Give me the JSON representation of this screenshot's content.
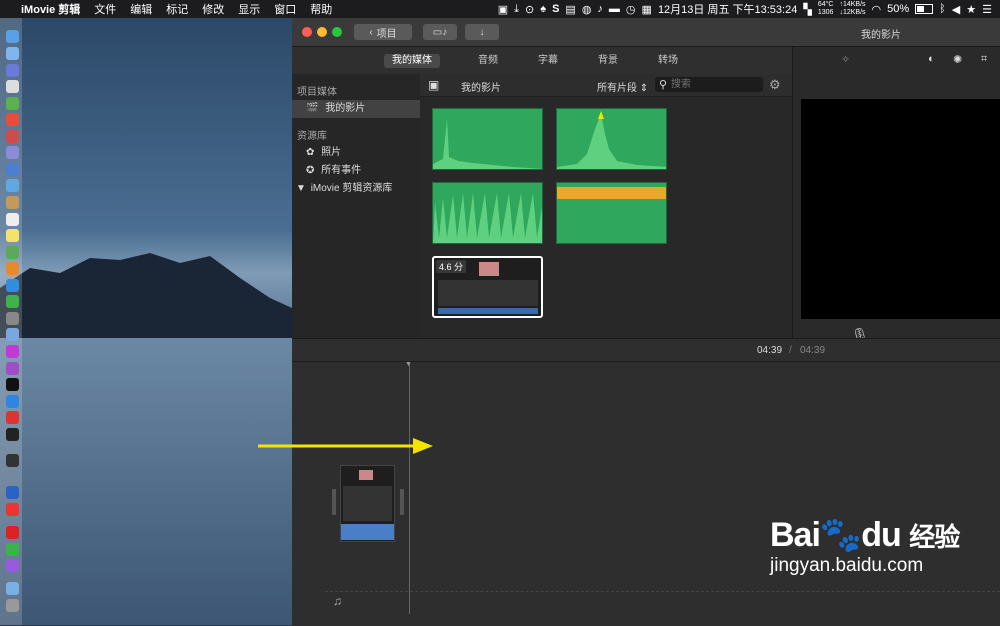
{
  "menubar": {
    "apple": "",
    "app_name": "iMovie 剪辑",
    "menus": [
      "文件",
      "编辑",
      "标记",
      "修改",
      "显示",
      "窗口",
      "帮助"
    ],
    "datetime": "12月13日 周五 下午13:53:24",
    "temp": "64°C",
    "fan": "1306",
    "net_up": "↑14KB/s",
    "net_down": "↓12KB/s",
    "battery": "50%"
  },
  "window": {
    "back_button": "项目",
    "title": "我的影片"
  },
  "tabs": [
    "我的媒体",
    "音频",
    "字幕",
    "背景",
    "转场"
  ],
  "sidebar": {
    "section1": "项目媒体",
    "project": "我的影片",
    "section2": "资源库",
    "photos": "照片",
    "all_events": "所有事件",
    "library": "iMovie 剪辑资源库"
  },
  "browser": {
    "title": "我的影片",
    "filter": "所有片段",
    "search_placeholder": "搜索",
    "clip_duration": "4.6 分"
  },
  "timeline": {
    "current": "04:39",
    "separator": "/",
    "total": "04:39"
  },
  "watermark": {
    "brand": "Bai",
    "brand2": "du",
    "jingyan": "经验",
    "url": "jingyan.baidu.com"
  },
  "colors": {
    "clip_green": "#2fa85e",
    "arrow": "#f2e400",
    "audio_blue": "#4a7fc8"
  }
}
